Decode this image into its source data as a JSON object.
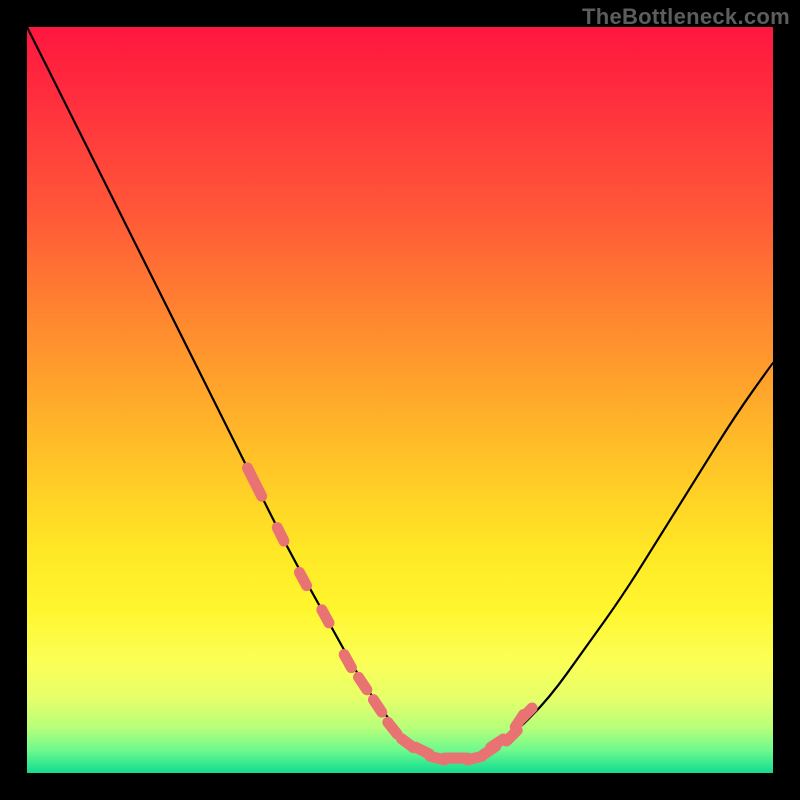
{
  "watermark": {
    "text": "TheBottleneck.com"
  },
  "colors": {
    "background": "#000000",
    "gradient_top": "#ff163f",
    "gradient_mid": "#ffe726",
    "gradient_bottom": "#18da8e",
    "curve": "#000000",
    "marker": "#e97373"
  },
  "chart_data": {
    "type": "line",
    "title": "",
    "xlabel": "",
    "ylabel": "",
    "xlim": [
      0,
      100
    ],
    "ylim": [
      0,
      100
    ],
    "x": [
      0,
      5,
      10,
      15,
      20,
      25,
      30,
      35,
      40,
      45,
      48,
      50,
      52,
      55,
      58,
      60,
      62,
      65,
      70,
      75,
      80,
      85,
      90,
      95,
      100
    ],
    "values": [
      100,
      90,
      80,
      70,
      60,
      50,
      40,
      30,
      21,
      12,
      8,
      5,
      3,
      2,
      2,
      2,
      3,
      5,
      10,
      17,
      24,
      32,
      40,
      48,
      55
    ],
    "marked_x": [
      30,
      31,
      34,
      37,
      40,
      43,
      45,
      47,
      49,
      51,
      53,
      55,
      57,
      58,
      60,
      62,
      63,
      65,
      66,
      67
    ],
    "marked_values": [
      40,
      38,
      32,
      26,
      21,
      15,
      12,
      9,
      6,
      4,
      3,
      2,
      2,
      2,
      2,
      3,
      4,
      5,
      7,
      8
    ]
  }
}
